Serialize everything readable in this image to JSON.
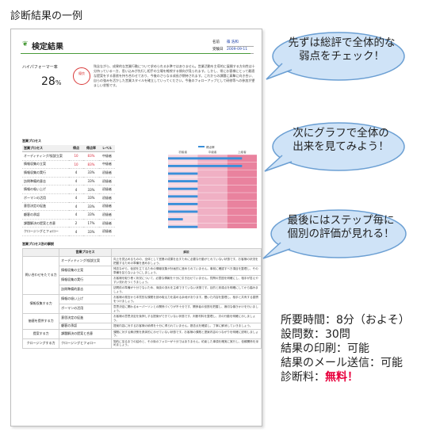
{
  "caption": "診断結果の一例",
  "report": {
    "icon": "leaf-icon",
    "title": "検定結果",
    "meta": [
      {
        "label": "名前",
        "value": "篠 浩和"
      },
      {
        "label": "受験日",
        "value": "2009-09-11"
      }
    ],
    "score_label": "ハイパフォーマー率",
    "score_value": "28",
    "score_unit": "%",
    "stamp_text": "優良",
    "summary": "残念ながら、成果的な営業行動について求められる水準ではありません。営業活動を主導的に展開する方向性は十分持っている一方、思い込みが先行し相手の立場を軽視する傾向が見られます。しかし、常にお客様にとって最適な提案をする意欲を持ち合わせており、今後のさらなる成長が期待されます。これからの課題に真摯に向き合い、自らの強みを活かした営業スタイルを確立していってください。今後のフォローアップとして研修等への参加が望ましい状態です。",
    "section1_title": "営業プロセス",
    "table1_headers": [
      "営業プロセス",
      "得点",
      "得点率",
      "レベル"
    ],
    "table1_rows": [
      {
        "process": "オーディティング/仮説立案",
        "score": "10",
        "rate": "83%",
        "level": "中級者",
        "high": true
      },
      {
        "process": "情報収集の立案",
        "score": "10",
        "rate": "83%",
        "level": "中級者",
        "high": true
      },
      {
        "process": "情報収集の実行",
        "score": "4",
        "rate": "33%",
        "level": "初級者",
        "high": false
      },
      {
        "process": "訪問準備的意志",
        "score": "4",
        "rate": "33%",
        "level": "初級者",
        "high": false
      },
      {
        "process": "情報の吸い上げ",
        "score": "4",
        "rate": "33%",
        "level": "初級者",
        "high": false
      },
      {
        "process": "ボーマンの活用",
        "score": "4",
        "rate": "33%",
        "level": "初級者",
        "high": false
      },
      {
        "process": "意思決定の促進",
        "score": "4",
        "rate": "33%",
        "level": "初級者",
        "high": false
      },
      {
        "process": "顧客の承認",
        "score": "4",
        "rate": "33%",
        "level": "初級者",
        "high": false
      },
      {
        "process": "課題解決の提案と合意",
        "score": "2",
        "rate": "17%",
        "level": "初級者",
        "high": false
      },
      {
        "process": "クロージングとフォロー",
        "score": "4",
        "rate": "33%",
        "level": "初級者",
        "high": false
      }
    ],
    "section2_title": "営業プロセス別の解説",
    "table2_headers": [
      "",
      "営業プロセス",
      "解説"
    ],
    "table2_groups": [
      {
        "group": "問い合わせをたてる力",
        "rows": [
          {
            "process": "オーディティング/仮説立案",
            "desc": "向上を見込めるものの、全体として営業の成果を出すために必要な行動がとれていない状態です。お客様の状況を把握するための準備を進めましょう。"
          },
          {
            "process": "情報収集の立案",
            "desc": "残念ながら、仮説を立てるための情報収集が計画的に進められていません。事前に確認すべき項目を整理し、その準備を怠らないようにしましょう。"
          },
          {
            "process": "情報収集の実行",
            "desc": "お客様を取り巻く状況について、必要な情報を十分に引き出せていません。質問の意図を明確にし、相手が答えやすい流れをつくりましょう。"
          },
          {
            "process": "訪問準備的意志",
            "desc": "訪問前の準備が十分でないため、商談の流れを主導できていない状態です。目的と到達点を明確にしてから臨みましょう。"
          }
        ]
      },
      {
        "group": "情報収集する力",
        "rows": [
          {
            "process": "情報の吸い上げ",
            "desc": "お客様の発言から本質的な課題を読み取る力を高める余地があります。聞いた内容を整理し、相手と共有する習慣をつけましょう。"
          },
          {
            "process": "ボーマンの活用",
            "desc": "意思決定に関わるキーパーソンとの関係づくりが不十分です。関係者の役割を把握し、適切な働きかけを行いましょう。"
          }
        ]
      },
      {
        "group": "価値を提供する力",
        "rows": [
          {
            "process": "意思決定の促進",
            "desc": "お客様の意思決定を後押しする提案ができていない状態です。判断材料を整理し、次の行動を明確に示しましょう。"
          },
          {
            "process": "顧客の承認",
            "desc": "提案内容に対するお客様の納得を十分に得られていません。懸念点を確認し、丁寧に解消していきましょう。"
          }
        ]
      },
      {
        "group": "提案する力",
        "rows": [
          {
            "process": "課題解決の提案と合意",
            "desc": "課題に対する解決策を具体的に示せていない状態です。お客様の課題と提案内容のつながりを明確に説明しましょう。"
          }
        ]
      },
      {
        "group": "クロージングする力",
        "rows": [
          {
            "process": "クロージングとフォロー",
            "desc": "契約に至るまでの詰めと、その後のフォローが十分ではありません。約束した事項を確実に実行し、信頼関係を深めましょう。"
          }
        ]
      }
    ]
  },
  "chart_data": {
    "type": "bar",
    "orientation": "horizontal",
    "legend": [
      "得点率"
    ],
    "legend_position": "top",
    "band_labels": [
      "初級者",
      "中級者",
      "上級者"
    ],
    "categories": [
      "オーディティング/仮説立案",
      "情報収集の立案",
      "情報収集の実行",
      "訪問準備的意志",
      "情報の吸い上げ",
      "ボーマンの活用",
      "意思決定の促進",
      "顧客の承認",
      "課題解決の提案と合意",
      "クロージングとフォロー"
    ],
    "values": [
      10,
      10,
      4,
      4,
      4,
      4,
      4,
      4,
      2,
      4
    ],
    "xlim": [
      0,
      12
    ],
    "xticks": [
      "0",
      "4",
      "8",
      "12"
    ],
    "colors": {
      "bar": "#3a8fd9",
      "band1": "#f7d6e0",
      "band2": "#f0b0c4",
      "band3": "#e9829e"
    }
  },
  "bubbles": [
    {
      "text": "先ずは総評で全体的な\n弱点をチェック！"
    },
    {
      "text": "次にグラフで全体の\n出来を見てみよう！"
    },
    {
      "text": "最後にはステップ毎に\n個別の評価が見れる！"
    }
  ],
  "info": {
    "duration": "所要時間：8分（およそ）",
    "questions": "設問数：30問",
    "print": "結果の印刷：可能",
    "mail": "結果のメール送信：可能",
    "fee_label": "診断料：",
    "fee_value": "無料！"
  },
  "colors": {
    "accent": "#4a9b3a",
    "bubble_fill": "#cfe3f7",
    "bubble_stroke": "#6b9fd3",
    "free": "#e8003d"
  }
}
